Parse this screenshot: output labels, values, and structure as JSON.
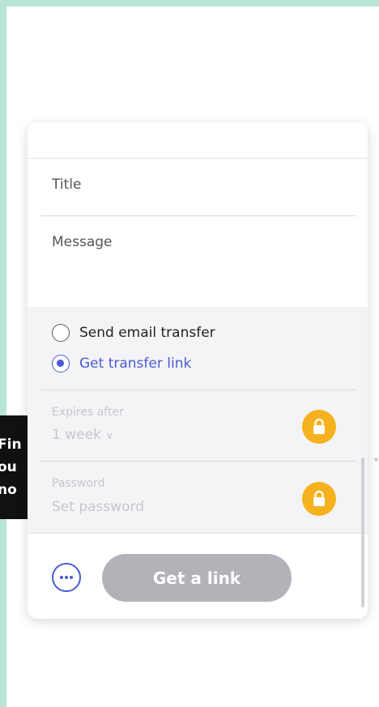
{
  "promo": {
    "lines": [
      "Fin",
      "ou",
      "no"
    ]
  },
  "form": {
    "title_placeholder": "Title",
    "message_placeholder": "Message"
  },
  "delivery": {
    "options": [
      {
        "label": "Send email transfer",
        "selected": false
      },
      {
        "label": "Get transfer link",
        "selected": true
      }
    ]
  },
  "settings": {
    "expires_label": "Expires after",
    "expires_value": "1 week",
    "password_label": "Password",
    "password_placeholder": "Set password"
  },
  "actions": {
    "more_icon": "more-options-icon",
    "primary_label": "Get a link"
  },
  "colors": {
    "background": "#b9e5d7",
    "accent": "#4c5bd4",
    "lock": "#f6b21e",
    "button_disabled": "#b1b3b9"
  }
}
